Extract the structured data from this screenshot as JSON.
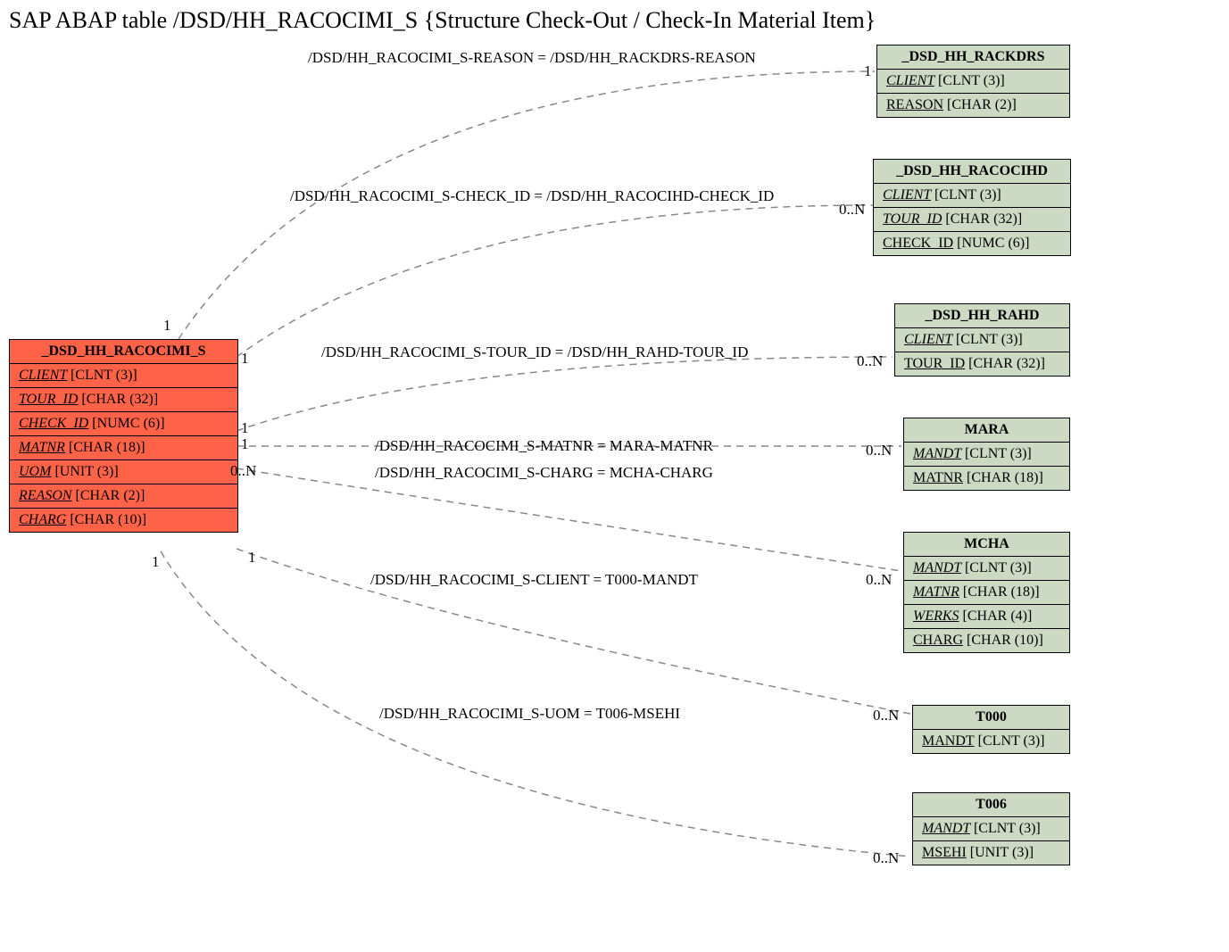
{
  "title": "SAP ABAP table /DSD/HH_RACOCIMI_S {Structure Check-Out / Check-In Material Item}",
  "source": {
    "name": "_DSD_HH_RACOCIMI_S",
    "fields": [
      {
        "name": "CLIENT",
        "type": "[CLNT (3)]",
        "key": true
      },
      {
        "name": "TOUR_ID",
        "type": "[CHAR (32)]",
        "key": true
      },
      {
        "name": "CHECK_ID",
        "type": "[NUMC (6)]",
        "key": true
      },
      {
        "name": "MATNR",
        "type": "[CHAR (18)]",
        "key": true
      },
      {
        "name": "UOM",
        "type": "[UNIT (3)]",
        "key": true
      },
      {
        "name": "REASON",
        "type": "[CHAR (2)]",
        "key": true
      },
      {
        "name": "CHARG",
        "type": "[CHAR (10)]",
        "key": true
      }
    ]
  },
  "targets": [
    {
      "name": "_DSD_HH_RACKDRS",
      "fields": [
        {
          "name": "CLIENT",
          "type": "[CLNT (3)]",
          "key": true
        },
        {
          "name": "REASON",
          "type": "[CHAR (2)]",
          "key": false
        }
      ]
    },
    {
      "name": "_DSD_HH_RACOCIHD",
      "fields": [
        {
          "name": "CLIENT",
          "type": "[CLNT (3)]",
          "key": true
        },
        {
          "name": "TOUR_ID",
          "type": "[CHAR (32)]",
          "key": true
        },
        {
          "name": "CHECK_ID",
          "type": "[NUMC (6)]",
          "key": false
        }
      ]
    },
    {
      "name": "_DSD_HH_RAHD",
      "fields": [
        {
          "name": "CLIENT",
          "type": "[CLNT (3)]",
          "key": true
        },
        {
          "name": "TOUR_ID",
          "type": "[CHAR (32)]",
          "key": false
        }
      ]
    },
    {
      "name": "MARA",
      "fields": [
        {
          "name": "MANDT",
          "type": "[CLNT (3)]",
          "key": true
        },
        {
          "name": "MATNR",
          "type": "[CHAR (18)]",
          "key": false
        }
      ]
    },
    {
      "name": "MCHA",
      "fields": [
        {
          "name": "MANDT",
          "type": "[CLNT (3)]",
          "key": true
        },
        {
          "name": "MATNR",
          "type": "[CHAR (18)]",
          "key": true
        },
        {
          "name": "WERKS",
          "type": "[CHAR (4)]",
          "key": true
        },
        {
          "name": "CHARG",
          "type": "[CHAR (10)]",
          "key": false
        }
      ]
    },
    {
      "name": "T000",
      "fields": [
        {
          "name": "MANDT",
          "type": "[CLNT (3)]",
          "key": false
        }
      ]
    },
    {
      "name": "T006",
      "fields": [
        {
          "name": "MANDT",
          "type": "[CLNT (3)]",
          "key": true
        },
        {
          "name": "MSEHI",
          "type": "[UNIT (3)]",
          "key": false
        }
      ]
    }
  ],
  "relations": [
    {
      "label": "/DSD/HH_RACOCIMI_S-REASON = /DSD/HH_RACKDRS-REASON",
      "left_card": "1",
      "right_card": "1"
    },
    {
      "label": "/DSD/HH_RACOCIMI_S-CHECK_ID = /DSD/HH_RACOCIHD-CHECK_ID",
      "left_card": "1",
      "right_card": "0..N"
    },
    {
      "label": "/DSD/HH_RACOCIMI_S-TOUR_ID = /DSD/HH_RAHD-TOUR_ID",
      "left_card": "1",
      "right_card": "0..N"
    },
    {
      "label": "/DSD/HH_RACOCIMI_S-MATNR = MARA-MATNR",
      "left_card": "1",
      "right_card": "0..N"
    },
    {
      "label": "/DSD/HH_RACOCIMI_S-CHARG = MCHA-CHARG",
      "left_card": "0..N",
      "right_card": ""
    },
    {
      "label": "/DSD/HH_RACOCIMI_S-CLIENT = T000-MANDT",
      "left_card": "1",
      "right_card": "0..N"
    },
    {
      "label": "/DSD/HH_RACOCIMI_S-UOM = T006-MSEHI",
      "left_card": "1",
      "right_card": "0..N"
    }
  ]
}
